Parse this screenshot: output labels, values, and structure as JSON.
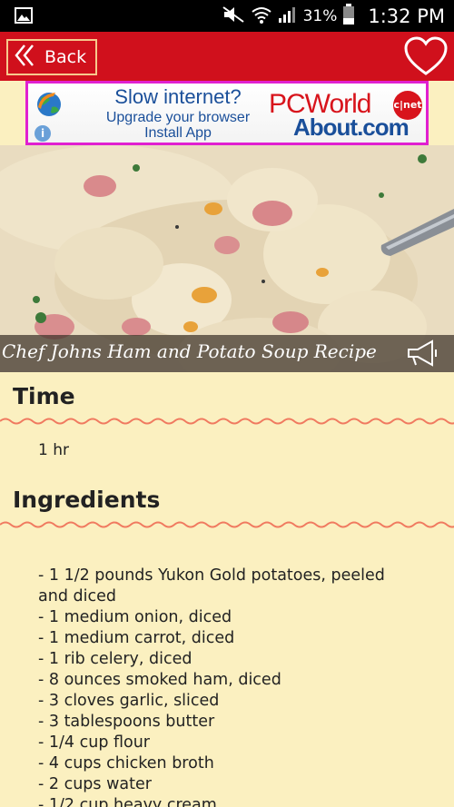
{
  "status_bar": {
    "icons": [
      "image-icon",
      "mute-icon",
      "wifi-icon",
      "signal-icon",
      "battery-icon"
    ],
    "battery_percent": "31%",
    "time": "1:32 PM"
  },
  "header": {
    "back_label": "Back",
    "icons": [
      "double-chevron-left-icon",
      "heart-icon"
    ],
    "color": "#d0101c"
  },
  "ad": {
    "headline": "Slow internet?",
    "line1": "Upgrade your browser",
    "line2": "Install App",
    "brand1": "PCWorld",
    "brand_badge": "c|net",
    "brand2": "About.com",
    "info_glyph": "i"
  },
  "recipe": {
    "title": "Chef Johns Ham and Potato Soup Recipe",
    "time_heading": "Time",
    "time_value": "1 hr",
    "ingredients_heading": "Ingredients",
    "ingredients": [
      "-  1 1/2 pounds Yukon Gold potatoes, peeled and diced",
      "-  1 medium onion, diced",
      "-  1 medium carrot, diced",
      "-  1 rib celery, diced",
      "-  8 ounces smoked ham, diced",
      "-  3 cloves garlic, sliced",
      "-  3 tablespoons butter",
      "-  1/4 cup flour",
      "-  4 cups chicken broth",
      "-  2 cups water",
      "-  1/2 cup heavy cream"
    ]
  },
  "colors": {
    "background": "#fbf0c0",
    "accent_red": "#d0101c",
    "wavy_line": "#f07a60"
  }
}
